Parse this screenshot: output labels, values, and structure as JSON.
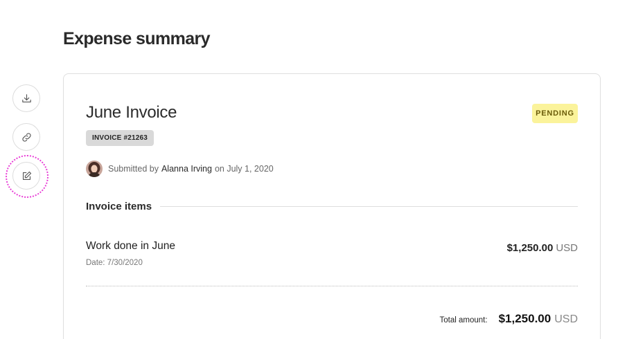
{
  "page": {
    "title": "Expense summary"
  },
  "side_actions": [
    {
      "icon": "download-icon"
    },
    {
      "icon": "link-icon"
    },
    {
      "icon": "edit-icon",
      "highlighted": true
    }
  ],
  "invoice": {
    "title": "June Invoice",
    "status": "PENDING",
    "number_tag": "INVOICE #21263",
    "submitted_prefix": "Submitted by",
    "submitted_by": "Alanna Irving",
    "submitted_suffix": "on July 1, 2020"
  },
  "items_section": {
    "title": "Invoice items"
  },
  "items": [
    {
      "name": "Work done in June",
      "date": "Date: 7/30/2020",
      "amount": "$1,250.00",
      "currency": "USD"
    }
  ],
  "total": {
    "label": "Total amount:",
    "amount": "$1,250.00",
    "currency": "USD"
  },
  "colors": {
    "status_bg": "#fbf39b",
    "highlight": "#e83cd6",
    "tag_bg": "#d9d9d9"
  }
}
